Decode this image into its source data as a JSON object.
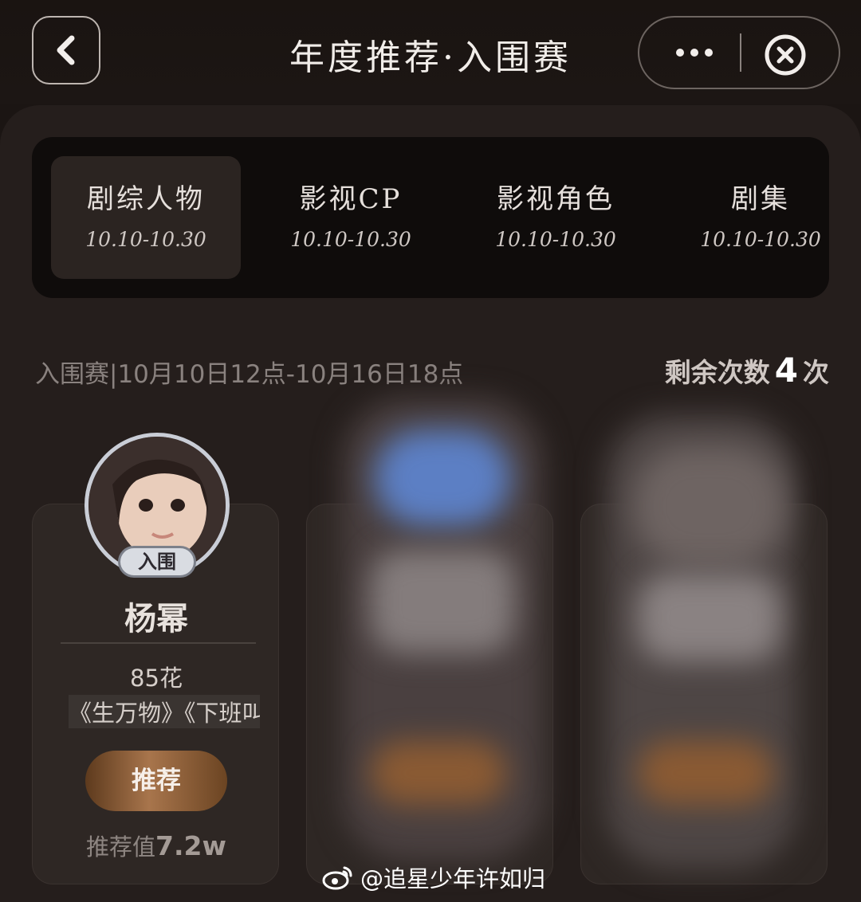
{
  "header": {
    "title": "年度推荐·入围赛"
  },
  "tabs": [
    {
      "label": "剧综人物",
      "date": "10.10-10.30"
    },
    {
      "label": "影视CP",
      "date": "10.10-10.30"
    },
    {
      "label": "影视角色",
      "date": "10.10-10.30"
    },
    {
      "label": "剧集",
      "date": "10.10-10.30"
    }
  ],
  "round_info": "入围赛|10月10日12点-10月16日18点",
  "remaining": {
    "prefix": "剩余次数",
    "count": "4",
    "suffix": "次"
  },
  "candidates": [
    {
      "badge": "入围",
      "name": "杨幂",
      "tagline": "85花",
      "works": "《生万物》《下班叫",
      "button": "推荐",
      "score_label": "推荐值",
      "score_value": "7.2w"
    }
  ],
  "icons": {
    "back": "chevron-left-icon",
    "more": "more-dots-icon",
    "close": "close-circle-icon",
    "weibo": "weibo-logo-icon"
  },
  "colors": {
    "background": "#1b1513",
    "panel": "#251e1c",
    "tab_bar": "#0f0c0b",
    "active_tab": "#2b2421",
    "button_gold": "#a8754c"
  },
  "watermark": "@追星少年许如归"
}
